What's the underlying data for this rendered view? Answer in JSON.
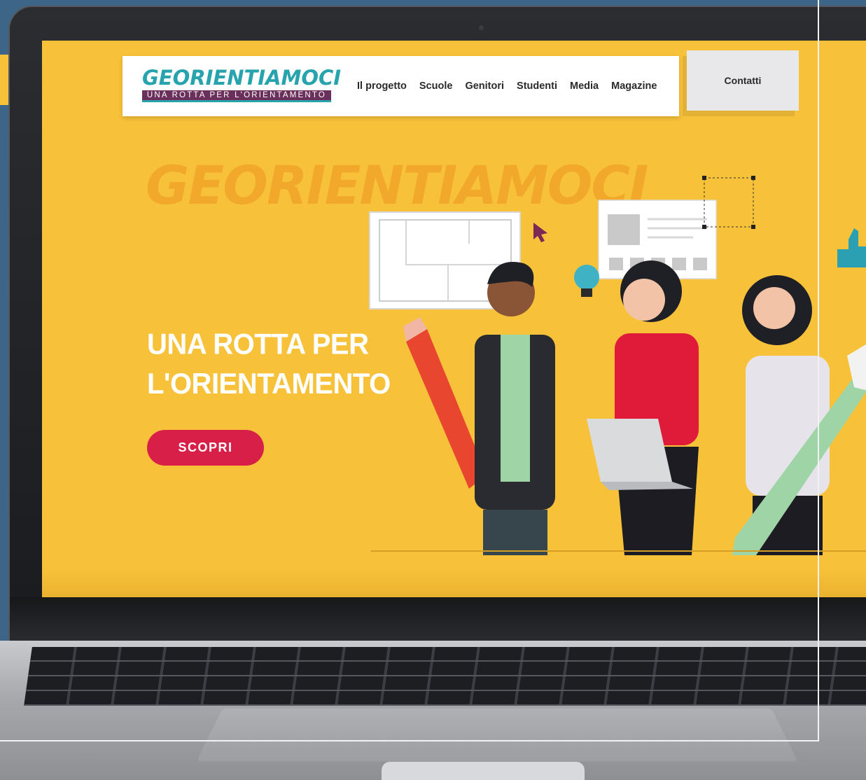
{
  "brand": {
    "logo_word": "GEORIENTIAMOCI",
    "logo_tagline": "UNA ROTTA PER L'ORIENTAMENTO",
    "graffiti_word": "GEORIENTIAMOCI"
  },
  "nav": {
    "items": [
      {
        "label": "Il progetto"
      },
      {
        "label": "Scuole"
      },
      {
        "label": "Genitori"
      },
      {
        "label": "Studenti"
      },
      {
        "label": "Media"
      },
      {
        "label": "Magazine"
      }
    ],
    "contact_label": "Contatti"
  },
  "hero": {
    "title_line1": "UNA ROTTA PER",
    "title_line2": "L'ORIENTAMENTO",
    "cta_label": "SCOPRI"
  },
  "colors": {
    "background": "#3d6587",
    "hero_yellow": "#f7c23a",
    "cta_red": "#d81f47",
    "logo_teal": "#27a3ad",
    "logo_purple": "#6b2f5c"
  },
  "icons": [
    "cursor-arrow-icon",
    "lightbulb-icon",
    "thumbs-up-icon",
    "pencil-illustration",
    "pen-nib-illustration",
    "laptop-illustration"
  ]
}
